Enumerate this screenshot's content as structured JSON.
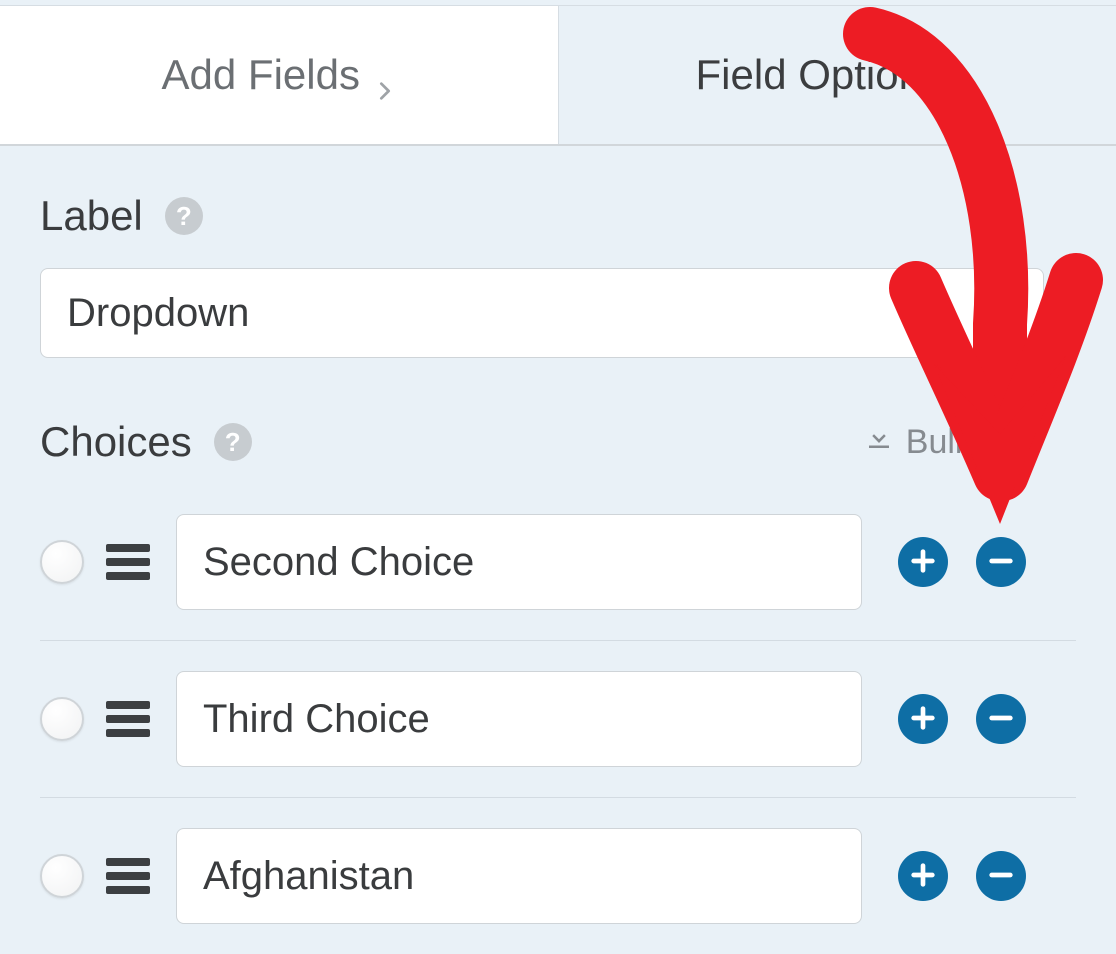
{
  "tabs": {
    "add_fields": "Add Fields",
    "field_options": "Field Options"
  },
  "label_section": {
    "title": "Label",
    "value": "Dropdown"
  },
  "choices_section": {
    "title": "Choices",
    "bulk_add": "Bulk Add"
  },
  "choices": [
    {
      "value": "Second Choice"
    },
    {
      "value": "Third Choice"
    },
    {
      "value": "Afghanistan"
    }
  ],
  "icons": {
    "help": "?",
    "plus": "+",
    "minus": "−"
  }
}
